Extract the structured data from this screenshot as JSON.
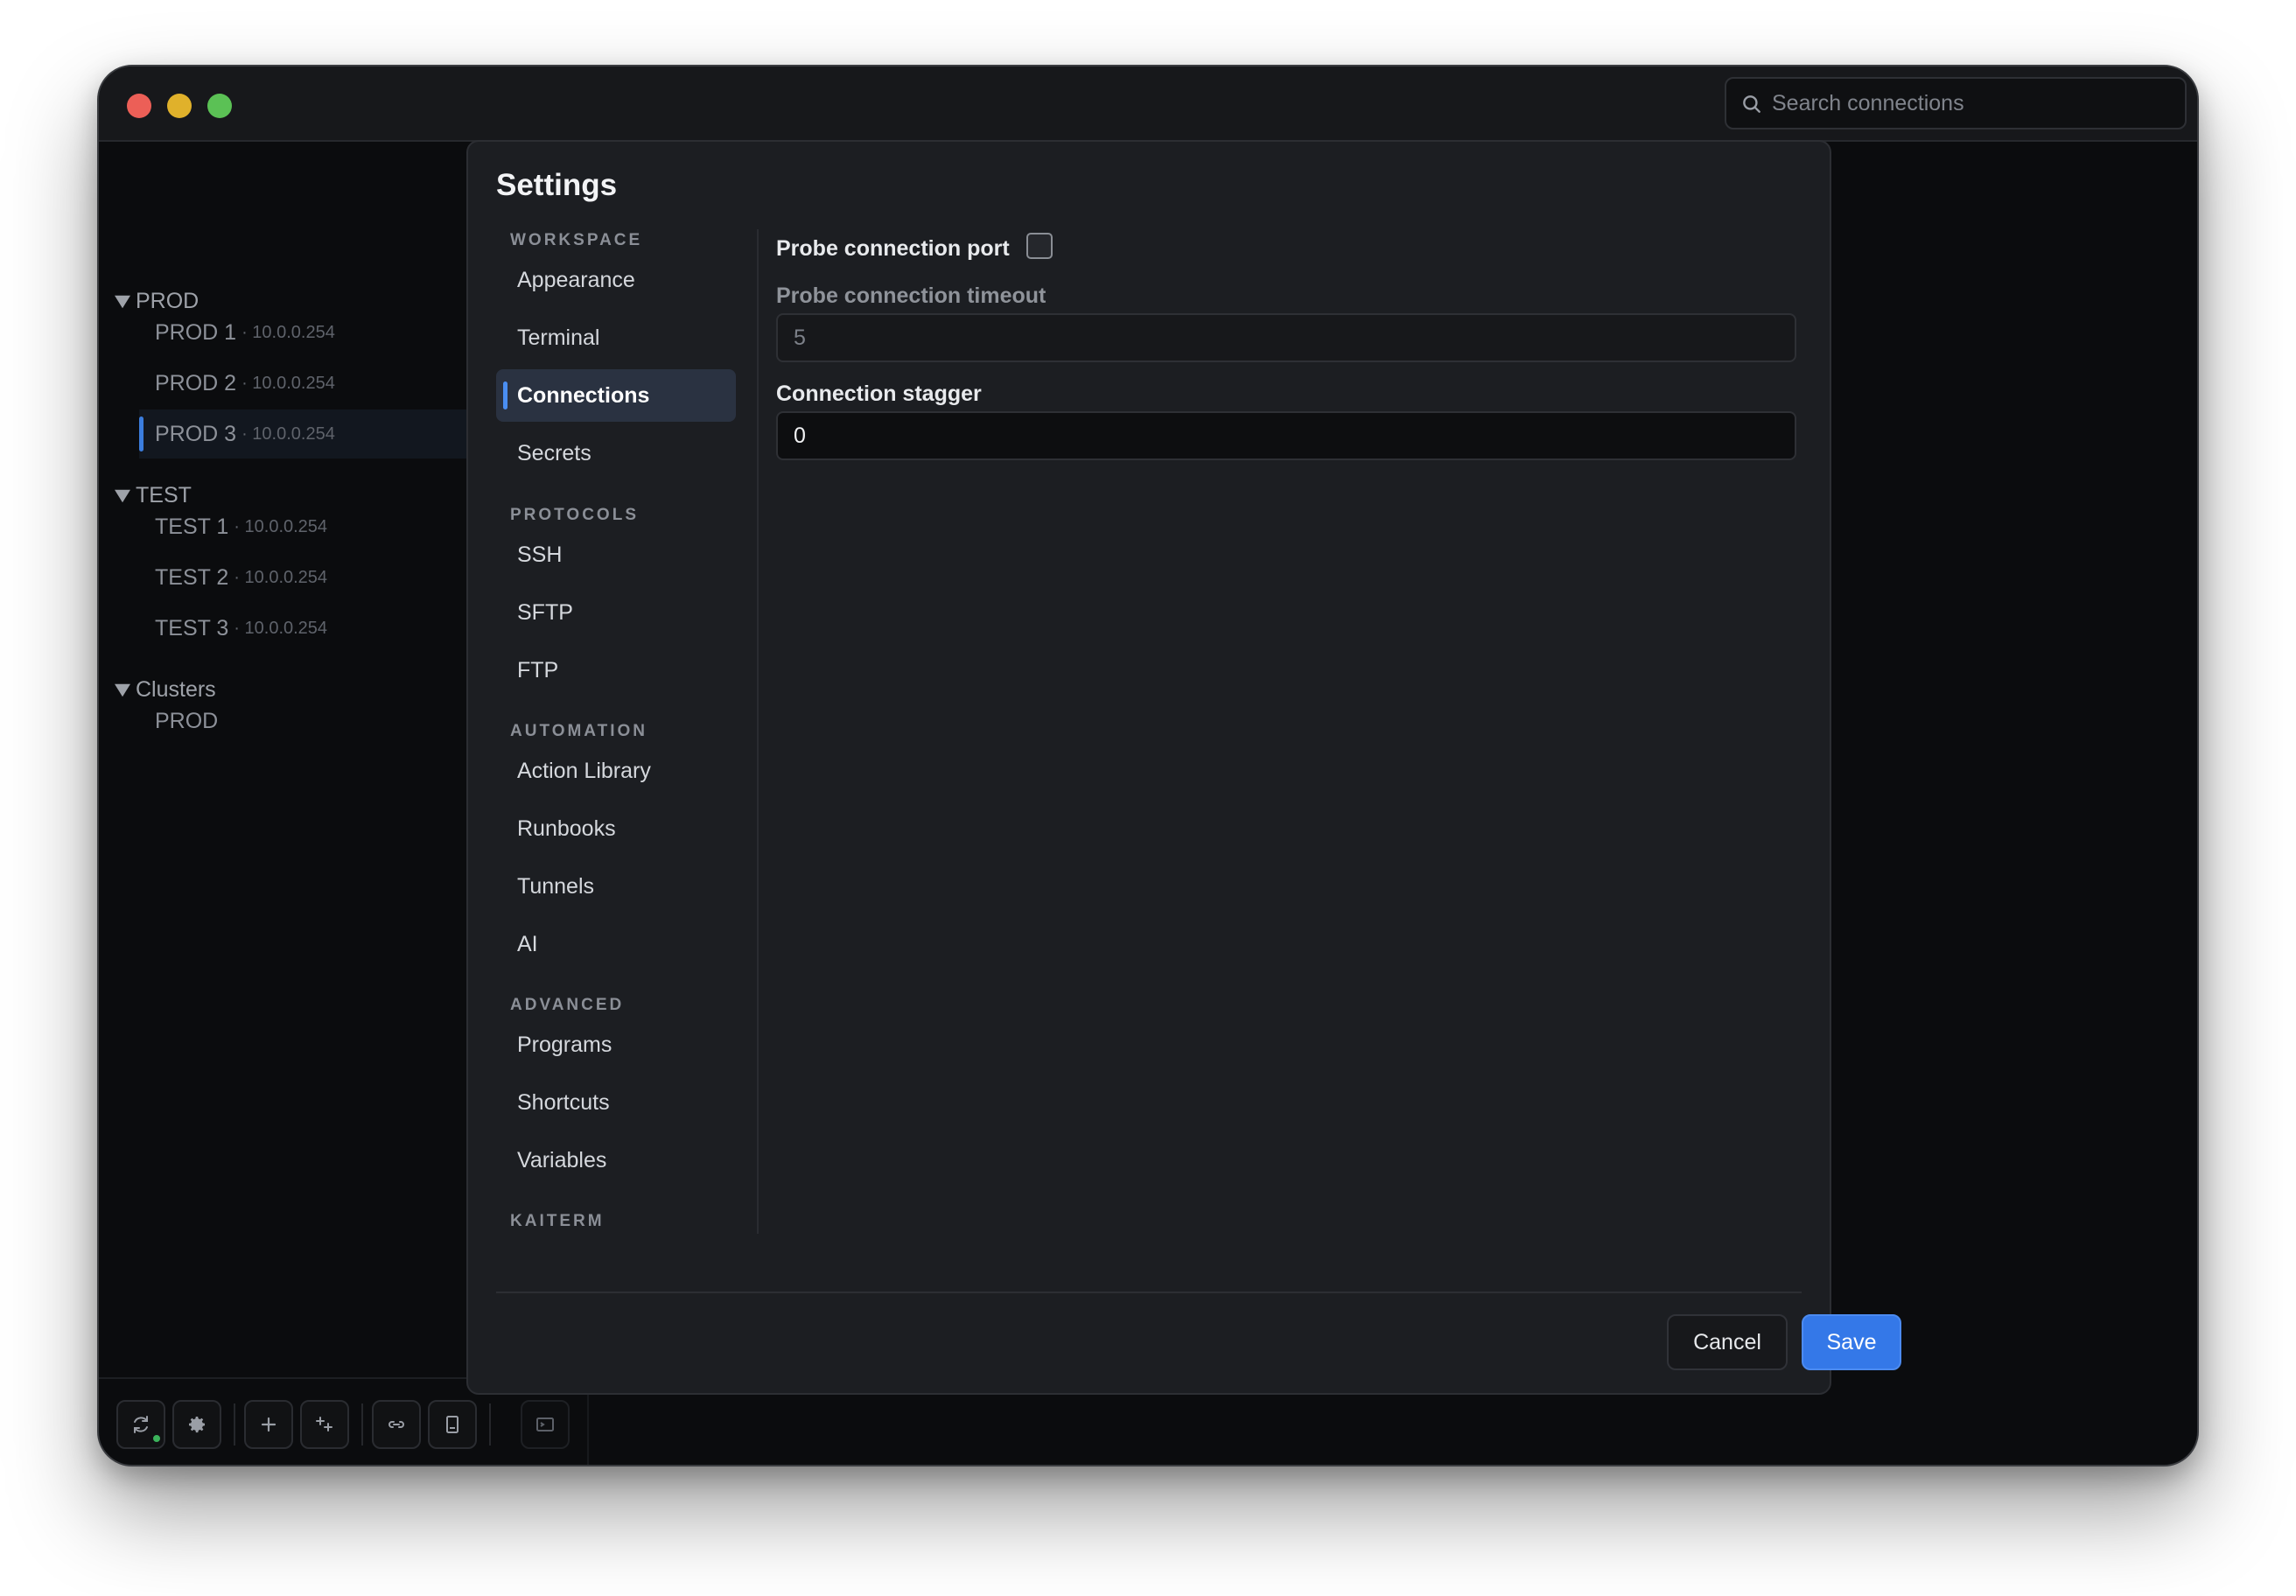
{
  "search": {
    "placeholder": "Search connections"
  },
  "tree": {
    "groups": [
      {
        "label": "PROD",
        "items": [
          {
            "name": "PROD 1",
            "ip": "· 10.0.0.254"
          },
          {
            "name": "PROD 2",
            "ip": "· 10.0.0.254"
          },
          {
            "name": "PROD 3",
            "ip": "· 10.0.0.254"
          }
        ]
      },
      {
        "label": "TEST",
        "items": [
          {
            "name": "TEST 1",
            "ip": "· 10.0.0.254"
          },
          {
            "name": "TEST 2",
            "ip": "· 10.0.0.254"
          },
          {
            "name": "TEST 3",
            "ip": "· 10.0.0.254"
          }
        ]
      },
      {
        "label": "Clusters",
        "items": [
          {
            "name": "PROD",
            "ip": ""
          }
        ]
      }
    ]
  },
  "settings": {
    "title": "Settings",
    "sections": [
      {
        "label": "WORKSPACE",
        "items": [
          "Appearance",
          "Terminal",
          "Connections",
          "Secrets"
        ]
      },
      {
        "label": "PROTOCOLS",
        "items": [
          "SSH",
          "SFTP",
          "FTP"
        ]
      },
      {
        "label": "AUTOMATION",
        "items": [
          "Action Library",
          "Runbooks",
          "Tunnels",
          "AI"
        ]
      },
      {
        "label": "ADVANCED",
        "items": [
          "Programs",
          "Shortcuts",
          "Variables"
        ]
      },
      {
        "label": "KAITERM",
        "items": []
      }
    ],
    "active_item": "Connections",
    "fields": {
      "probe_port_label": "Probe connection port",
      "probe_port_checked": false,
      "probe_timeout_label": "Probe connection timeout",
      "probe_timeout_value": "5",
      "stagger_label": "Connection stagger",
      "stagger_value": "0"
    },
    "buttons": {
      "cancel": "Cancel",
      "save": "Save"
    }
  },
  "colors": {
    "accent": "#3478e8",
    "status_online": "#3bb35b"
  }
}
